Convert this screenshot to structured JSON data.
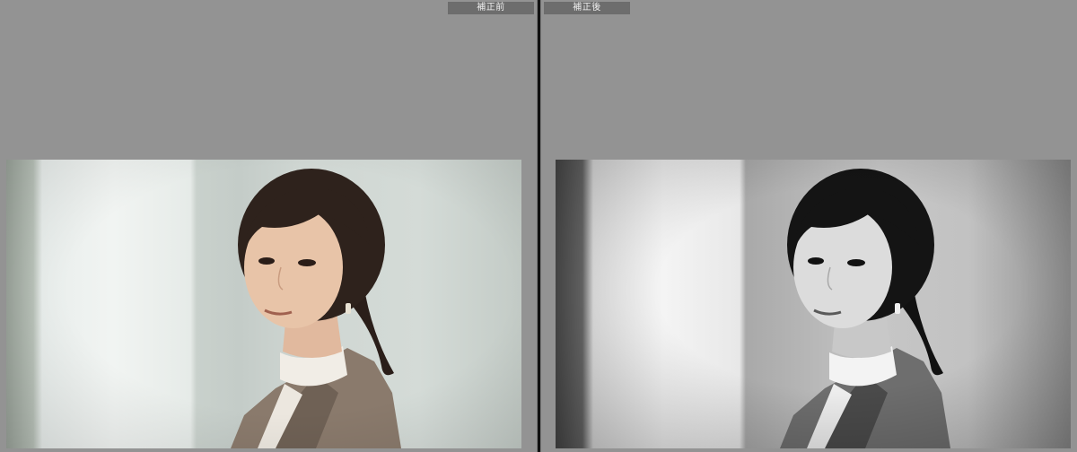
{
  "panes": {
    "before": {
      "label": "補正前"
    },
    "after": {
      "label": "補正後"
    }
  },
  "colors": {
    "background": "#939393",
    "label_bg": "#6d6d6d",
    "label_text": "#f0f0f0",
    "divider": "#111111"
  }
}
